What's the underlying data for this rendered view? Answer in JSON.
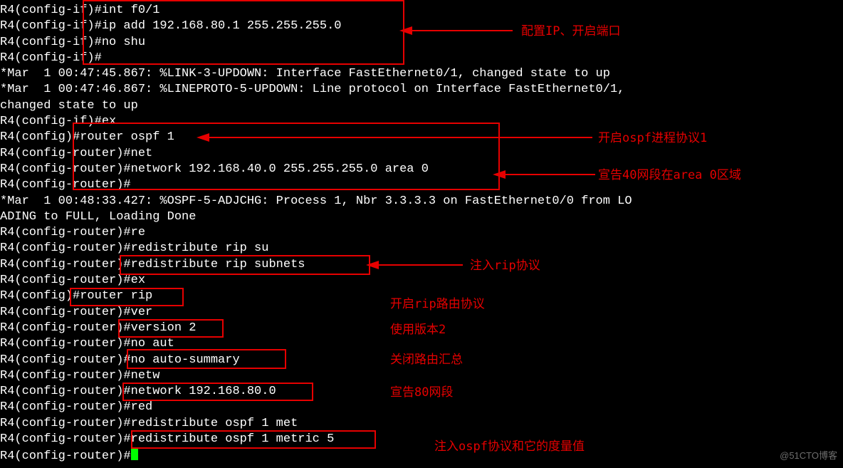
{
  "terminal": {
    "lines": [
      "R4(config-if)#int f0/1",
      "R4(config-if)#ip add 192.168.80.1 255.255.255.0",
      "R4(config-if)#no shu",
      "R4(config-if)#",
      "*Mar  1 00:47:45.867: %LINK-3-UPDOWN: Interface FastEthernet0/1, changed state to up",
      "*Mar  1 00:47:46.867: %LINEPROTO-5-UPDOWN: Line protocol on Interface FastEthernet0/1,",
      "changed state to up",
      "R4(config-if)#ex",
      "R4(config)#router ospf 1",
      "R4(config-router)#net",
      "R4(config-router)#network 192.168.40.0 255.255.255.0 area 0",
      "R4(config-router)#",
      "*Mar  1 00:48:33.427: %OSPF-5-ADJCHG: Process 1, Nbr 3.3.3.3 on FastEthernet0/0 from LO",
      "ADING to FULL, Loading Done",
      "R4(config-router)#re",
      "R4(config-router)#redistribute rip su",
      "R4(config-router)#redistribute rip subnets",
      "R4(config-router)#ex",
      "R4(config)#router rip",
      "R4(config-router)#ver",
      "R4(config-router)#version 2",
      "R4(config-router)#no aut",
      "R4(config-router)#no auto-summary",
      "R4(config-router)#netw",
      "R4(config-router)#network 192.168.80.0",
      "R4(config-router)#red",
      "R4(config-router)#redistribute ospf 1 met",
      "R4(config-router)#redistribute ospf 1 metric 5",
      "R4(config-router)#"
    ]
  },
  "annotations": {
    "a1": "配置IP、开启端口",
    "a2": "开启ospf进程协议1",
    "a3": "宣告40网段在area 0区域",
    "a4": "注入rip协议",
    "a5": "开启rip路由协议",
    "a6": "使用版本2",
    "a7": "关闭路由汇总",
    "a8": "宣告80网段",
    "a9": "注入ospf协议和它的度量值"
  },
  "watermark": "@51CTO博客",
  "colors": {
    "highlight": "#e60000",
    "bg": "#000000",
    "fg": "#ffffff",
    "cursor": "#00ff00"
  }
}
